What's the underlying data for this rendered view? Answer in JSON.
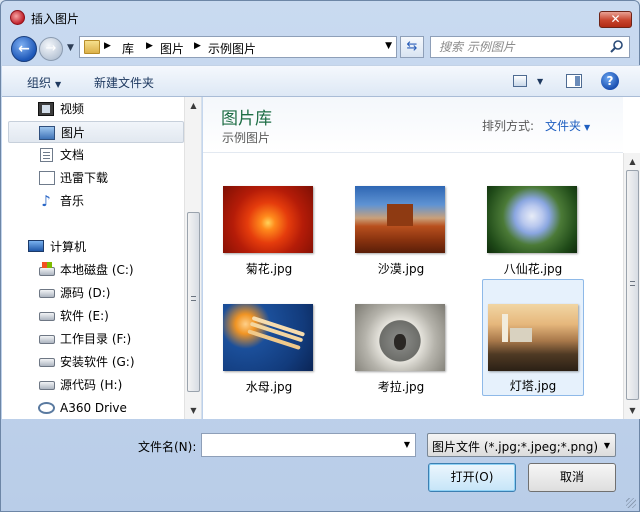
{
  "window": {
    "title": "插入图片",
    "close_glyph": "✕"
  },
  "nav_buttons": {
    "back_glyph": "←",
    "forward_glyph": "→"
  },
  "address": {
    "crumbs": [
      "库",
      "图片",
      "示例图片"
    ]
  },
  "search": {
    "placeholder": "搜索 示例图片"
  },
  "toolbar": {
    "organize_label": "组织",
    "new_folder_label": "新建文件夹",
    "help_glyph": "?"
  },
  "nav_pane": {
    "items": [
      {
        "label": "视频",
        "icon": "video-icon"
      },
      {
        "label": "图片",
        "icon": "pictures-icon",
        "selected": true
      },
      {
        "label": "文档",
        "icon": "document-icon"
      },
      {
        "label": "迅雷下载",
        "icon": "download-icon"
      },
      {
        "label": "音乐",
        "icon": "music-icon"
      },
      {
        "label": "计算机",
        "icon": "computer-icon"
      },
      {
        "label": "本地磁盘 (C:)",
        "icon": "system-disk-icon"
      },
      {
        "label": "源码 (D:)",
        "icon": "disk-icon"
      },
      {
        "label": "软件 (E:)",
        "icon": "disk-icon"
      },
      {
        "label": "工作目录 (F:)",
        "icon": "disk-icon"
      },
      {
        "label": "安装软件 (G:)",
        "icon": "disk-icon"
      },
      {
        "label": "源代码 (H:)",
        "icon": "disk-icon"
      },
      {
        "label": "A360 Drive",
        "icon": "cloud-drive-icon"
      }
    ]
  },
  "library": {
    "title": "图片库",
    "subtitle": "示例图片",
    "arrange_label": "排列方式:",
    "arrange_value": "文件夹"
  },
  "files": [
    {
      "name": "菊花.jpg"
    },
    {
      "name": "沙漠.jpg"
    },
    {
      "name": "八仙花.jpg"
    },
    {
      "name": "水母.jpg"
    },
    {
      "name": "考拉.jpg"
    },
    {
      "name": "灯塔.jpg",
      "selected": true
    }
  ],
  "bottom": {
    "filename_label": "文件名(N):",
    "filename_value": "",
    "filetype_value": "图片文件 (*.jpg;*.jpeg;*.png)",
    "open_label": "打开(O)",
    "cancel_label": "取消"
  },
  "colors": {
    "library_title": "#1e6e45",
    "link_blue": "#1f5fc0",
    "close_red": "#c8442d"
  }
}
